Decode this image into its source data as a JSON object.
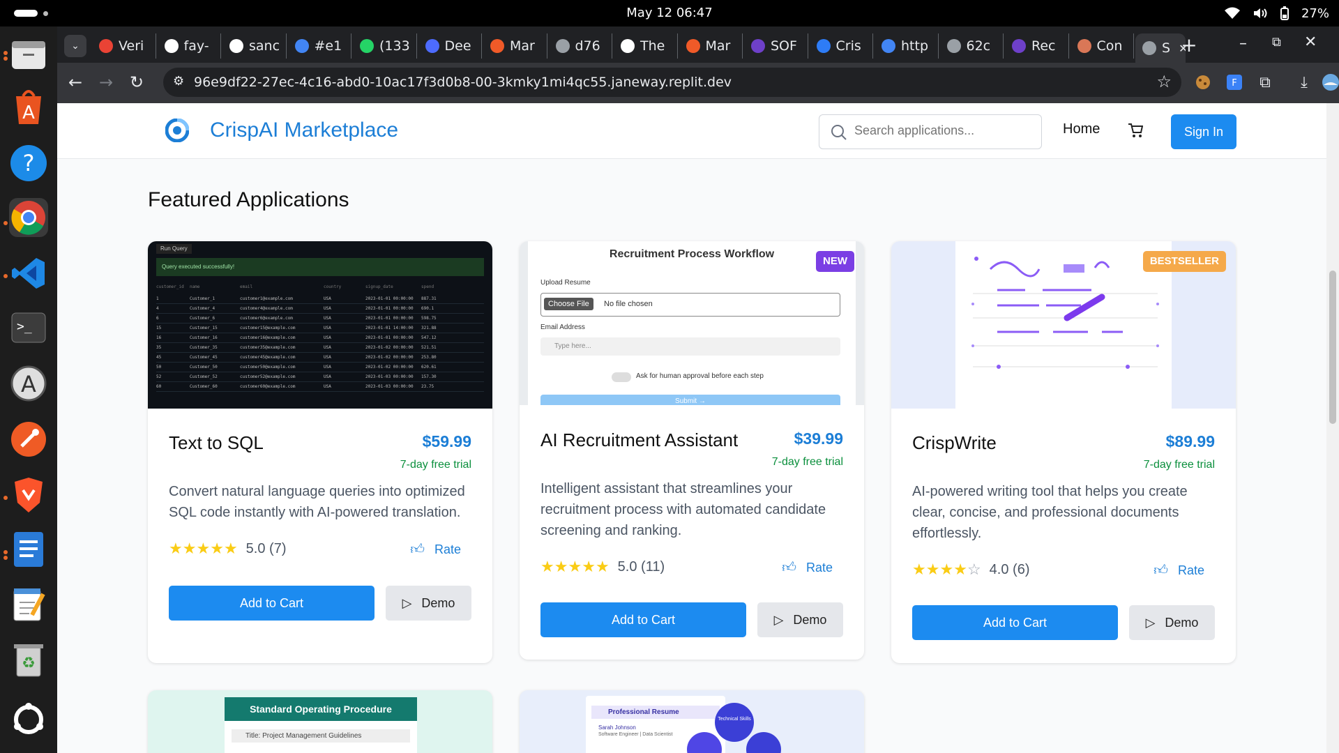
{
  "system": {
    "clock": "May 12  06:47",
    "battery": "27%"
  },
  "browser": {
    "tabs": [
      {
        "label": "Veri",
        "icon": "gmail-icon",
        "color": "#ea4335"
      },
      {
        "label": "fay-",
        "icon": "github-icon",
        "color": "#ffffff"
      },
      {
        "label": "sanc",
        "icon": "openai-icon",
        "color": "#ffffff"
      },
      {
        "label": "#e1",
        "icon": "google-icon",
        "color": "#4285f4"
      },
      {
        "label": "(133",
        "icon": "whatsapp-icon",
        "color": "#25d366"
      },
      {
        "label": "Dee",
        "icon": "deepseek-icon",
        "color": "#4d6bfe"
      },
      {
        "label": "Mar",
        "icon": "make-icon",
        "color": "#f05a28"
      },
      {
        "label": "d76",
        "icon": "globe-icon",
        "color": "#9aa0a6"
      },
      {
        "label": "The",
        "icon": "chat-icon",
        "color": "#ffffff"
      },
      {
        "label": "Mar",
        "icon": "make-icon",
        "color": "#f05a28"
      },
      {
        "label": "SOF",
        "icon": "mp-icon",
        "color": "#6e40c9"
      },
      {
        "label": "Cris",
        "icon": "edge-icon",
        "color": "#2e7cf6"
      },
      {
        "label": "http",
        "icon": "google-icon",
        "color": "#4285f4"
      },
      {
        "label": "62c",
        "icon": "globe-icon",
        "color": "#9aa0a6"
      },
      {
        "label": "Rec",
        "icon": "mp-icon",
        "color": "#6e40c9"
      },
      {
        "label": "Con",
        "icon": "claude-icon",
        "color": "#d97757"
      },
      {
        "label": "S",
        "icon": "globe-icon",
        "color": "#9aa0a6"
      }
    ],
    "url": "96e9df22-27ec-4c16-abd0-10ac17f3d0b8-00-3kmky1mi4qc55.janeway.replit.dev"
  },
  "site": {
    "brand": "CrispAI Marketplace",
    "search_placeholder": "Search applications...",
    "nav_home": "Home",
    "sign_in": "Sign In",
    "section_title": "Featured Applications"
  },
  "cards": [
    {
      "title": "Text to SQL",
      "price": "$59.99",
      "trial": "7-day free trial",
      "description": "Convert natural language queries into optimized SQL code instantly with AI-powered translation.",
      "rating": 5,
      "rating_text": "5.0 (7)",
      "rate_label": "Rate",
      "add_label": "Add to Cart",
      "demo_label": "Demo",
      "badge": ""
    },
    {
      "title": "AI Recruitment Assistant",
      "price": "$39.99",
      "trial": "7-day free trial",
      "description": "Intelligent assistant that streamlines your recruitment process with automated candidate screening and ranking.",
      "rating": 5,
      "rating_text": "5.0 (11)",
      "rate_label": "Rate",
      "add_label": "Add to Cart",
      "demo_label": "Demo",
      "badge": "NEW"
    },
    {
      "title": "CrispWrite",
      "price": "$89.99",
      "trial": "7-day free trial",
      "description": "AI-powered writing tool that helps you create clear, concise, and professional documents effortlessly.",
      "rating": 4,
      "rating_text": "4.0 (6)",
      "rate_label": "Rate",
      "add_label": "Add to Cart",
      "demo_label": "Demo",
      "badge": "BESTSELLER"
    }
  ],
  "sql_preview": {
    "run_label": "Run Query",
    "success": "Query executed successfully!",
    "headers": [
      "customer_id",
      "name",
      "email",
      "country",
      "signup_date",
      "spend"
    ],
    "rows": [
      [
        "1",
        "Customer_1",
        "customer1@example.com",
        "USA",
        "2023-01-01 00:00:00",
        "887.31"
      ],
      [
        "4",
        "Customer_4",
        "customer4@example.com",
        "USA",
        "2023-01-01 00:00:00",
        "690.1"
      ],
      [
        "6",
        "Customer_6",
        "customer6@example.com",
        "USA",
        "2023-01-01 00:00:00",
        "598.75"
      ],
      [
        "15",
        "Customer_15",
        "customer15@example.com",
        "USA",
        "2023-01-01 14:00:00",
        "321.88"
      ],
      [
        "16",
        "Customer_16",
        "customer16@example.com",
        "USA",
        "2023-01-01 00:00:00",
        "547.12"
      ],
      [
        "35",
        "Customer_35",
        "customer35@example.com",
        "USA",
        "2023-01-02 00:00:00",
        "521.51"
      ],
      [
        "45",
        "Customer_45",
        "customer45@example.com",
        "USA",
        "2023-01-02 00:00:00",
        "253.80"
      ],
      [
        "50",
        "Customer_50",
        "customer50@example.com",
        "USA",
        "2023-01-02 00:00:00",
        "620.61"
      ],
      [
        "52",
        "Customer_52",
        "customer52@example.com",
        "USA",
        "2023-01-03 00:00:00",
        "157.30"
      ],
      [
        "60",
        "Customer_60",
        "customer60@example.com",
        "USA",
        "2023-01-03 00:00:00",
        "23.75"
      ]
    ]
  },
  "recruit_preview": {
    "title": "Recruitment Process Workflow",
    "upload_label": "Upload Resume",
    "choose_file": "Choose File",
    "no_file": "No file chosen",
    "email_label": "Email Address",
    "email_placeholder": "Type here...",
    "toggle_label": "Ask for human approval before each step",
    "submit": "Submit →"
  },
  "sop_preview": {
    "title": "Standard Operating Procedure",
    "subtitle": "Title: Project Management Guidelines"
  },
  "resume_preview": {
    "title": "Professional Resume",
    "name": "Sarah Johnson",
    "role": "Software Engineer | Data Scientist",
    "bubble": "Technical Skills"
  }
}
